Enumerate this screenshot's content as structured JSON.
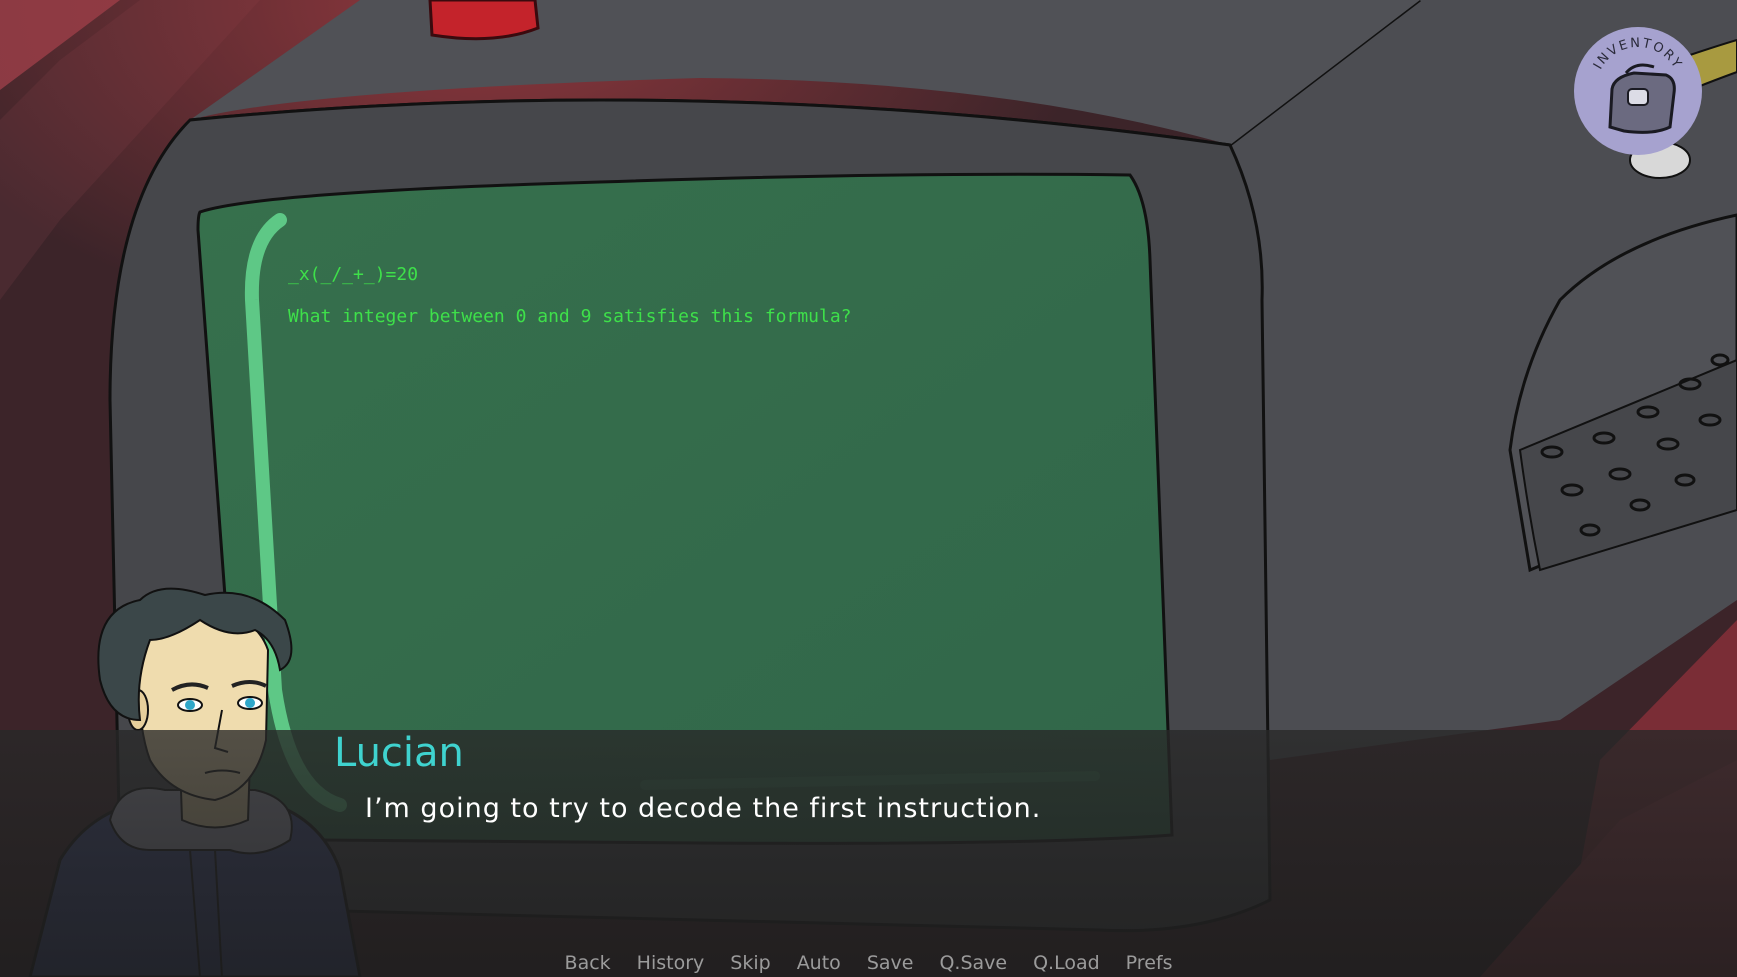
{
  "terminal": {
    "formula": "_x(_/_+_)=20",
    "question": "What integer between 0 and 9 satisfies this formula?"
  },
  "dialogue": {
    "speaker": "Lucian",
    "text": "I’m going to try to decode the first instruction."
  },
  "inventory": {
    "label": "INVENTORY",
    "icon": "bag-icon"
  },
  "quick_menu": {
    "back": "Back",
    "history": "History",
    "skip": "Skip",
    "auto": "Auto",
    "save": "Save",
    "qsave": "Q.Save",
    "qload": "Q.Load",
    "prefs": "Prefs"
  },
  "colors": {
    "terminal_text": "#3ee04a",
    "speaker_name": "#3fd3cf",
    "screen": "#336a4a",
    "inventory_bg": "#a6a2cf"
  }
}
